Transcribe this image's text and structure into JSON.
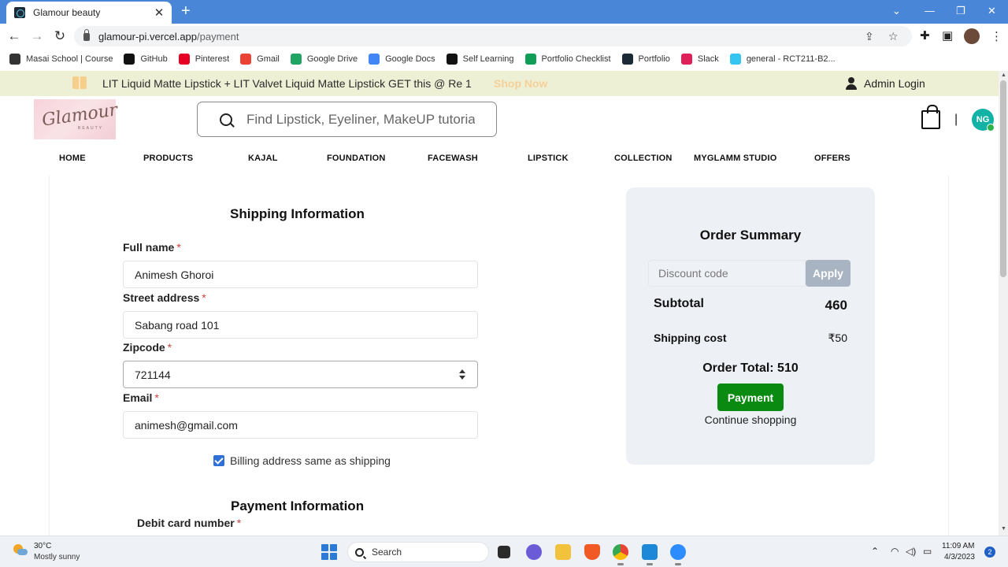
{
  "browser": {
    "tab_title": "Glamour beauty",
    "tab_close": "✕",
    "new_tab": "+",
    "url_host": "glamour-pi.vercel.app",
    "url_path": "/payment",
    "bookmarks": [
      {
        "label": "Masai School | Course",
        "icon": "masai-icon",
        "color": "#333333"
      },
      {
        "label": "GitHub",
        "icon": "github-icon",
        "color": "#111111"
      },
      {
        "label": "Pinterest",
        "icon": "pinterest-icon",
        "color": "#e60023"
      },
      {
        "label": "Gmail",
        "icon": "gmail-icon",
        "color": "#ea4335"
      },
      {
        "label": "Google Drive",
        "icon": "google-drive-icon",
        "color": "#1fa463"
      },
      {
        "label": "Google Docs",
        "icon": "google-docs-icon",
        "color": "#4285f4"
      },
      {
        "label": "Self Learning",
        "icon": "medium-icon",
        "color": "#111111"
      },
      {
        "label": "Portfolio Checklist",
        "icon": "google-sheets-icon",
        "color": "#0f9d58"
      },
      {
        "label": "Portfolio",
        "icon": "react-icon",
        "color": "#1b2a36"
      },
      {
        "label": "Slack",
        "icon": "slack-icon",
        "color": "#e01e5a"
      },
      {
        "label": "general - RCT211-B2...",
        "icon": "slack-icon",
        "color": "#36c5f0"
      }
    ]
  },
  "promo": {
    "text": "LIT Liquid Matte Lipstick + LIT Valvet Liquid Matte Lipstick GET this @ Re 1",
    "cta": "Shop Now",
    "admin": "Admin Login"
  },
  "header": {
    "logo_word": "Glamour",
    "logo_sub": "BEAUTY",
    "search_placeholder": "Find Lipstick, Eyeliner, MakeUP tutorial",
    "divider": "|",
    "avatar_initials": "NG"
  },
  "nav": [
    "HOME",
    "PRODUCTS",
    "KAJAL",
    "FOUNDATION",
    "FACEWASH",
    "LIPSTICK",
    "COLLECTION",
    "MYGLAMM STUDIO",
    "OFFERS"
  ],
  "shipping": {
    "title": "Shipping Information",
    "full_name_label": "Full name",
    "full_name_value": "Animesh Ghoroi",
    "street_label": "Street address",
    "street_value": "Sabang road 101",
    "zip_label": "Zipcode",
    "zip_value": "721144",
    "email_label": "Email",
    "email_value": "animesh@gmail.com",
    "required_mark": "*",
    "billing_same": "Billing address same as shipping",
    "billing_checked": true
  },
  "payment": {
    "title": "Payment Information",
    "debit_label": "Debit card number"
  },
  "summary": {
    "title": "Order Summary",
    "discount_placeholder": "Discount code",
    "apply": "Apply",
    "subtotal_label": "Subtotal",
    "subtotal_value": "460",
    "shipping_label": "Shipping cost",
    "shipping_value": "₹50",
    "total": "Order Total: 510",
    "pay_button": "Payment",
    "continue": "Continue shopping"
  },
  "taskbar": {
    "temp": "30°C",
    "condition": "Mostly sunny",
    "search": "Search",
    "time": "11:09 AM",
    "date": "4/3/2023",
    "notifications": "2"
  },
  "colors": {
    "accent_green": "#0a8a10",
    "promo_bg": "#eef0d6",
    "summary_bg": "#edf1f5",
    "avatar_bg": "#12b2a6",
    "tabbar_blue": "#4a86d8"
  }
}
